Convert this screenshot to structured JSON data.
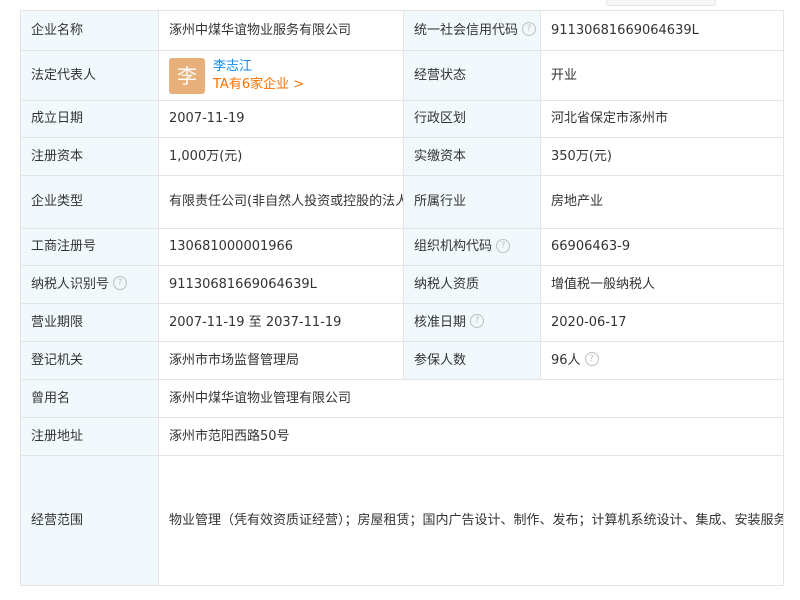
{
  "rows": {
    "company_name": {
      "label": "企业名称",
      "value": "涿州中煤华谊物业服务有限公司"
    },
    "credit_code": {
      "label": "统一社会信用代码",
      "value": "91130681669064639L"
    },
    "legal_rep": {
      "label": "法定代表人",
      "avatar": "李",
      "name": "李志江",
      "link": "TA有6家企业 >"
    },
    "status": {
      "label": "经营状态",
      "value": "开业"
    },
    "founded": {
      "label": "成立日期",
      "value": "2007-11-19"
    },
    "region": {
      "label": "行政区划",
      "value": "河北省保定市涿州市"
    },
    "reg_capital": {
      "label": "注册资本",
      "value": "1,000万(元)"
    },
    "paid_capital": {
      "label": "实缴资本",
      "value": "350万(元)"
    },
    "company_type": {
      "label": "企业类型",
      "value": "有限责任公司(非自然人投资或控股的法人独资)"
    },
    "industry": {
      "label": "所属行业",
      "value": "房地产业"
    },
    "biz_reg_no": {
      "label": "工商注册号",
      "value": "130681000001966"
    },
    "org_code": {
      "label": "组织机构代码",
      "value": "66906463-9"
    },
    "taxpayer_id": {
      "label": "纳税人识别号",
      "value": "91130681669064639L"
    },
    "taxpayer_qual": {
      "label": "纳税人资质",
      "value": "增值税一般纳税人"
    },
    "term": {
      "label": "营业期限",
      "value": "2007-11-19 至 2037-11-19"
    },
    "approval_date": {
      "label": "核准日期",
      "value": "2020-06-17"
    },
    "authority": {
      "label": "登记机关",
      "value": "涿州市市场监督管理局"
    },
    "insured": {
      "label": "参保人数",
      "value": "96人"
    },
    "former_name": {
      "label": "曾用名",
      "value": "涿州中煤华谊物业管理有限公司"
    },
    "address": {
      "label": "注册地址",
      "value": "涿州市范阳西路50号"
    },
    "scope": {
      "label": "经营范围",
      "value": "物业管理（凭有效资质证经营）；房屋租赁；国内广告设计、制作、发布；计算机系统设计、集成、安装服务；建筑工程装饰装修；园林绿化工程服务；家庭服务（不含劳务派遣）；清洁服务；家用电器维修；房地产经纪业务；会议及展览展示服务；建筑材料、装饰材料、五金产品、家用电器、电线电缆销售；餐饮服务；住宿服务；食品、烟酒零售；智能化安装工程服务；计算机及其他外部设备维修服务；电话业务代理服务；通讯设备修理；蔬菜、水果、食用菌、苗木、花卉种植、销售；农产品初加工服务；休闲观光服务；销售"
    }
  },
  "help_glyph": "?",
  "colors": {
    "label_bg": "#f2f9fc",
    "border": "#e4e4e4",
    "link_blue": "#128bed",
    "link_orange": "#fd7000",
    "avatar_bg": "#e7b07a"
  }
}
